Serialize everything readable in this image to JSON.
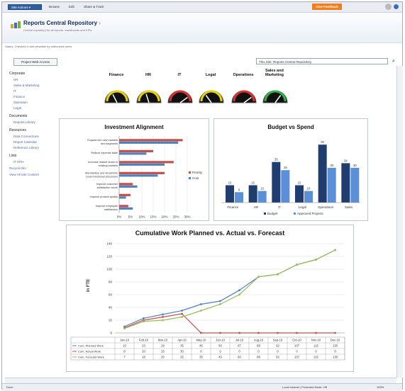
{
  "topbar": {
    "site_actions": "Site Actions ▾",
    "browse": "Browse",
    "edit": "Edit",
    "share": "Share & Track",
    "feedback": "Give Feedback"
  },
  "header": {
    "title": "Reports Central Repository",
    "arrow": "›",
    "subtitle": "Central repository for all reports, dashboards and KPIs"
  },
  "status": "Status: Checked in and viewable by authorized users",
  "project_tab": "Project Web Access",
  "search": {
    "placeholder": "This Site: Reports Central Repository"
  },
  "sidebar": {
    "groups": [
      {
        "label": "Corporate",
        "items": [
          "HR",
          "Sales & Marketing",
          "IT",
          "Finance",
          "Operation",
          "Legal"
        ]
      },
      {
        "label": "Documents",
        "items": [
          "Reports Library"
        ]
      },
      {
        "label": "Resources",
        "items": [
          "Data Connections",
          "Report Calendar",
          "Reference Library"
        ]
      },
      {
        "label": "Lists",
        "items": [
          "IT KPIs"
        ]
      }
    ],
    "recycle": "Recycle Bin",
    "view_all": "View All Site Content"
  },
  "gauges": [
    {
      "label": "Finance",
      "level": 0.35,
      "color": "#e8d200"
    },
    {
      "label": "HR",
      "level": 0.4,
      "color": "#e8d200"
    },
    {
      "label": "IT",
      "level": 0.8,
      "color": "#e23030"
    },
    {
      "label": "Legal",
      "level": 0.3,
      "color": "#e8d200"
    },
    {
      "label": "Operations",
      "level": 0.8,
      "color": "#e23030"
    },
    {
      "label": "Sales and\nMarketing",
      "level": 0.7,
      "color": "#2fb54a"
    }
  ],
  "chart_data": [
    {
      "type": "bar",
      "title": "Investment Alignment",
      "orientation": "horizontal",
      "categories": [
        "Expand into new markets and segments",
        "Reduce expense base",
        "Increase market share in existing markets",
        "Standardize and streamline cross-functional processes",
        "Improve customer satisfaction score",
        "Improve product quality",
        "Improve employee satisfaction"
      ],
      "series": [
        {
          "name": "Priority",
          "color": "#c0504d",
          "values": [
            28,
            15,
            24,
            20,
            6,
            5,
            4
          ]
        },
        {
          "name": "Cost",
          "color": "#4f81bd",
          "values": [
            26,
            12,
            20,
            17,
            8,
            3,
            6
          ]
        }
      ],
      "xticks": [
        "0%",
        "5%",
        "10%",
        "15%",
        "20%",
        "25%",
        "30%"
      ],
      "xlim": [
        0,
        30
      ]
    },
    {
      "type": "bar",
      "title": "Budget vs Spend",
      "categories": [
        "Finance",
        "HR",
        "IT",
        "Legal",
        "Operations",
        "Sales"
      ],
      "series": [
        {
          "name": "Budget",
          "color": "#1f3d6e",
          "values": [
            15,
            15,
            35,
            15,
            50,
            34
          ]
        },
        {
          "name": "Approved Projects",
          "color": "#5b8fd8",
          "values": [
            9,
            10,
            28,
            10,
            30,
            30
          ]
        }
      ],
      "ylim": [
        0,
        55
      ]
    },
    {
      "type": "line",
      "title": "Cumulative Work Planned vs. Actual vs. Forecast",
      "ylabel": "in FTE",
      "categories": [
        "Jan-10",
        "Feb-10",
        "Mar-10",
        "Apr-10",
        "May-10",
        "Jun-10",
        "Jul-10",
        "Aug-10",
        "Sep-10",
        "Oct-10",
        "Nov-10",
        "Dec-10"
      ],
      "yticks": [
        "0",
        "20",
        "40",
        "60",
        "80",
        "100",
        "120",
        "140"
      ],
      "ylim": [
        0,
        140
      ],
      "series": [
        {
          "name": "Cum. Planned Work",
          "color": "#4f81bd",
          "values": [
            10,
            23,
            29,
            35,
            45,
            50,
            67,
            88,
            92,
            107,
            115,
            130
          ]
        },
        {
          "name": "Cum. Actual Work",
          "color": "#c0504d",
          "values": [
            8,
            20,
            25,
            30,
            0,
            0,
            0,
            0,
            0,
            0,
            0,
            0
          ]
        },
        {
          "name": "Cum. Forecast Work",
          "color": "#9bbb59",
          "values": [
            7,
            18,
            20,
            25,
            35,
            45,
            60,
            88,
            92,
            107,
            115,
            130
          ]
        }
      ]
    }
  ],
  "statusline": {
    "left": "Done",
    "zone": "Local intranet | Protected Mode: Off",
    "zoom": "100%"
  }
}
